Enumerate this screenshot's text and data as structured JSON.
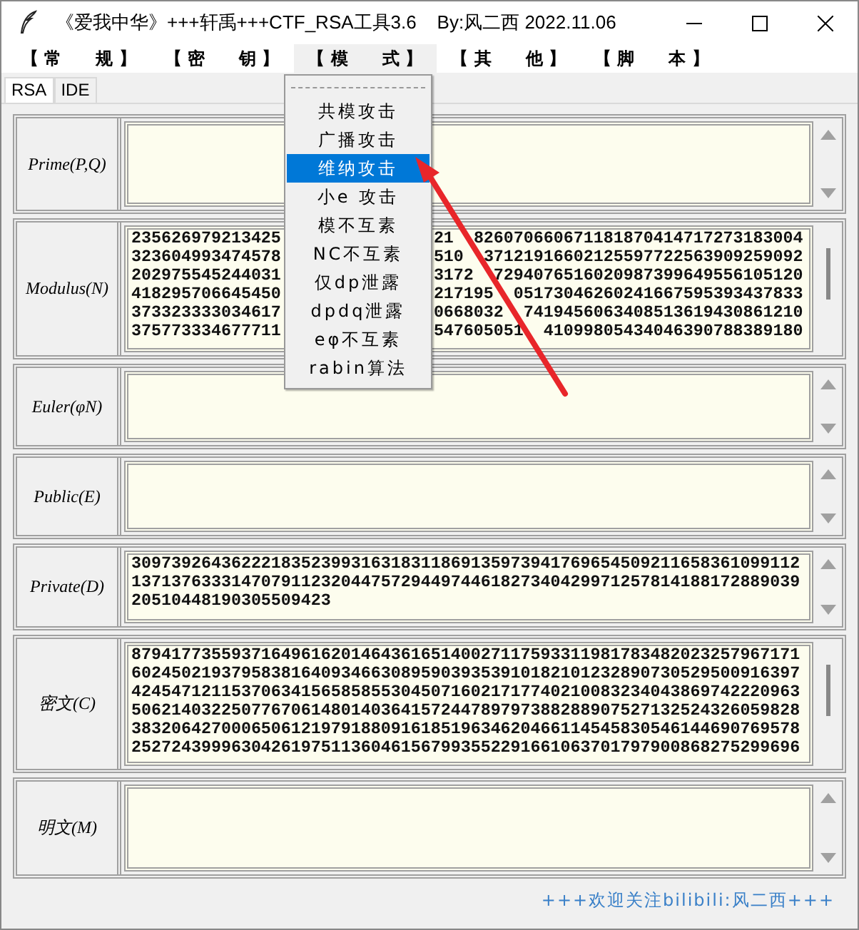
{
  "window": {
    "title": "《爱我中华》+++轩禹+++CTF_RSA工具3.6    By:风二西 2022.11.06"
  },
  "menubar": [
    {
      "label": "【 常　　规 】",
      "selected": false
    },
    {
      "label": "【 密　　钥 】",
      "selected": false
    },
    {
      "label": "【 模　　式 】",
      "selected": true
    },
    {
      "label": "【 其　　他 】",
      "selected": false
    },
    {
      "label": "【 脚　　本 】",
      "selected": false
    }
  ],
  "tabs": [
    {
      "label": "RSA",
      "selected": true
    },
    {
      "label": "IDE",
      "selected": false
    }
  ],
  "fields": [
    {
      "label": "Prime(P,Q)"
    },
    {
      "label": "Modulus(N)",
      "lines": [
        [
          "235626979213425",
          "21",
          "826070660671181870414717273183004"
        ],
        [
          "323604993474578",
          "510",
          "37121916602125597722563909259092"
        ],
        [
          "202975545244031",
          "3172",
          "7294076516020987399649556105120"
        ],
        [
          "418295706645450",
          "217195",
          "05173046260241667595393437833"
        ],
        [
          "373323333034617",
          "0668032",
          "7419456063408513619430861210"
        ],
        [
          "375773334677711",
          "547605051",
          "41099805434046390788389180"
        ]
      ]
    },
    {
      "label": "Euler(φN)"
    },
    {
      "label": "Public(E)"
    },
    {
      "label": "Private(D)",
      "lines": [
        [
          "3097392643622218352399316318311869135973941769654509211658361099112"
        ],
        [
          "1371376333147079112320447572944974461827340429971257814188172889039"
        ],
        [
          "20510448190305509423"
        ]
      ]
    },
    {
      "label": "密文(C)",
      "lines": [
        [
          "8794177355937164961620146436165140027117593311981783482023257967171"
        ],
        [
          "6024502193795838164093466308959039353910182101232890730529500916397"
        ],
        [
          "4245471211537063415658585530450716021717740210083234043869742220963"
        ],
        [
          "5062140322507767061480140364157244789797388288907527132524326059828"
        ],
        [
          "3832064270006506121979188091618519634620466114545830546144690769578"
        ],
        [
          "2527243999630426197511360461567993552291661063701797900868275299696"
        ]
      ]
    },
    {
      "label": "明文(M)"
    }
  ],
  "dropdown": {
    "items": [
      {
        "label": "共模攻击",
        "selected": false
      },
      {
        "label": "广播攻击",
        "selected": false
      },
      {
        "label": "维纳攻击",
        "selected": true
      },
      {
        "label": "小e 攻击",
        "selected": false
      },
      {
        "label": "模不互素",
        "selected": false
      },
      {
        "label": "NC不互素",
        "selected": false
      },
      {
        "label": "仅dp泄露",
        "selected": false
      },
      {
        "label": "dpdq泄露",
        "selected": false
      },
      {
        "label": "eφ不互素",
        "selected": false
      },
      {
        "label": "rabin算法",
        "selected": false
      }
    ]
  },
  "footer": "+++欢迎关注bilibili:风二西+++"
}
